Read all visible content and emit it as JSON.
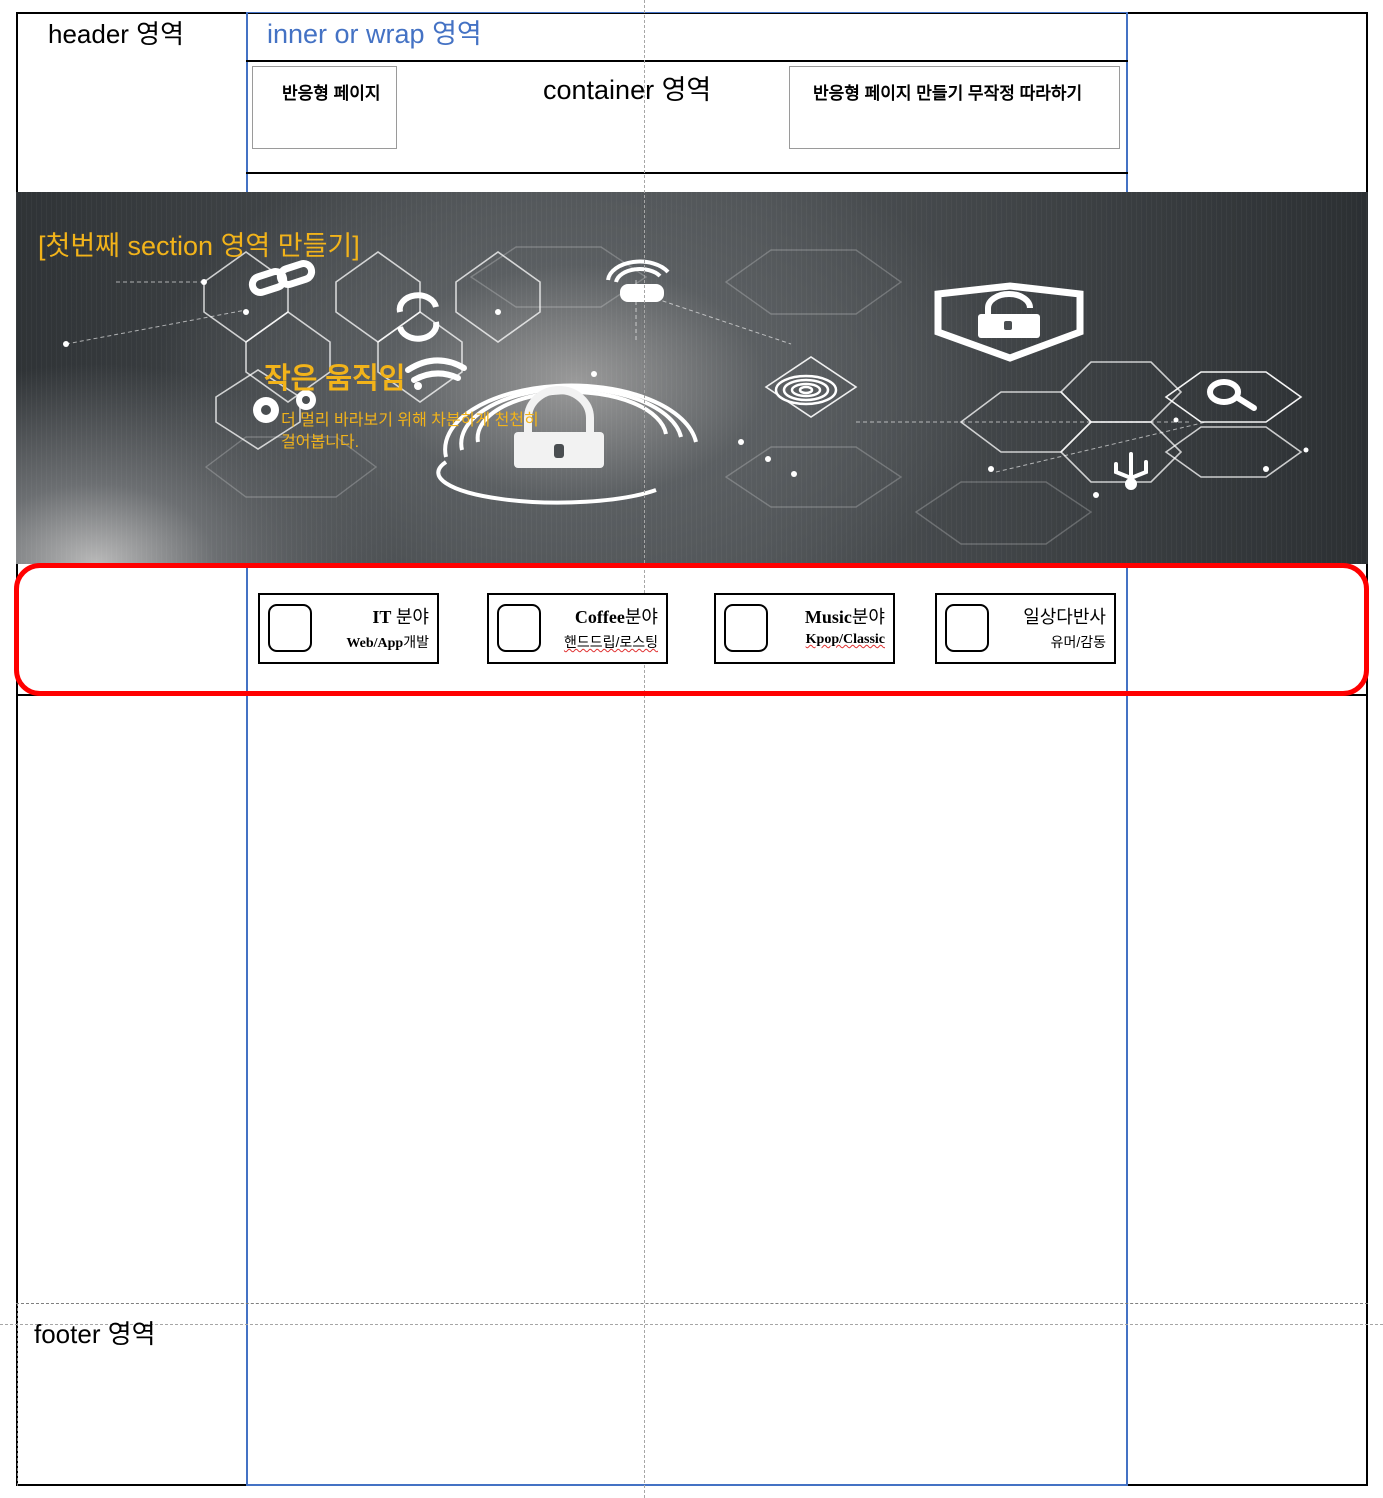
{
  "header": {
    "label": "header 영역",
    "wrap_label": "inner or wrap 영역",
    "container_label": "container 영역",
    "left_box_text": "반응형 페이지",
    "right_box_text": "반응형 페이지 만들기 무작정 따라하기"
  },
  "banner": {
    "title": "[첫번째 section 영역 만들기]",
    "subtitle": "작은 움직임",
    "desc_line1": "더 멀리 바라보기 위해 차분하게 천천히",
    "desc_line2": "걸어봅니다.",
    "icons": [
      "link-icon",
      "refresh-icon",
      "wifi-icon",
      "gears-icon",
      "padlock-icon",
      "fingerprint-icon",
      "shield-lock-icon",
      "search-icon",
      "usb-icon",
      "signal-tower-icon"
    ]
  },
  "categories": [
    {
      "title_bold": "IT",
      "title_rest": " 분야",
      "sub": "Web/App",
      "sub_rest": "개발"
    },
    {
      "title_bold": "Coffee",
      "title_rest": "분야",
      "sub": "핸드드립/로스팅",
      "sub_rest": ""
    },
    {
      "title_bold": "Music",
      "title_rest": "분야",
      "sub": "Kpop/Classic",
      "sub_rest": ""
    },
    {
      "title_bold": "",
      "title_rest": "일상다반사",
      "sub": "유머/감동",
      "sub_rest": ""
    }
  ],
  "footer": {
    "label": "footer 영역"
  },
  "colors": {
    "wrap_guide": "#4472c4",
    "banner_text": "#f2b31a",
    "highlight": "#ff0000"
  }
}
